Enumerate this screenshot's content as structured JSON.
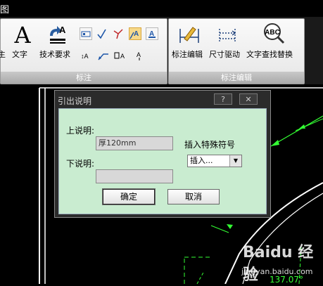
{
  "title_strip": "图",
  "ribbon": {
    "panel1": {
      "footer": "标注",
      "large_buttons": [
        {
          "label": "文字",
          "icon": "letter-a-icon"
        },
        {
          "label": "技术要求",
          "icon": "tech-req-icon"
        }
      ],
      "left_cut_label": "主",
      "small_tools": [
        "leader-datum-icon",
        "checkmark-icon",
        "slope-icon",
        "leader-text-icon",
        "text-frame-icon",
        "swap-text-icon",
        "leader-arrow-icon",
        "box-a-icon",
        "up-a-icon"
      ]
    },
    "panel2": {
      "footer": "标注编辑",
      "buttons": [
        {
          "label": "标注编辑",
          "icon": "dim-edit-icon"
        },
        {
          "label": "尺寸驱动",
          "icon": "dim-drive-icon"
        },
        {
          "label": "文字查找替换",
          "icon": "abc-search-icon"
        }
      ]
    }
  },
  "dialog": {
    "title": "引出说明",
    "help_button": "?",
    "close_button": "✕",
    "upper_label": "上说明:",
    "upper_value": "厚120mm",
    "lower_label": "下说明:",
    "lower_value": "",
    "special_label": "插入特殊符号",
    "special_select": "插入...",
    "ok": "确定",
    "cancel": "取消"
  },
  "canvas": {
    "dimension_text": "137.07°",
    "watermark_main": "Baidu 经验",
    "watermark_url": "jingyan.baidu.com"
  },
  "colors": {
    "drawing_green": "#33ff33",
    "dialog_body": "#c9ecd0",
    "active_tool": "#f6d98a"
  }
}
